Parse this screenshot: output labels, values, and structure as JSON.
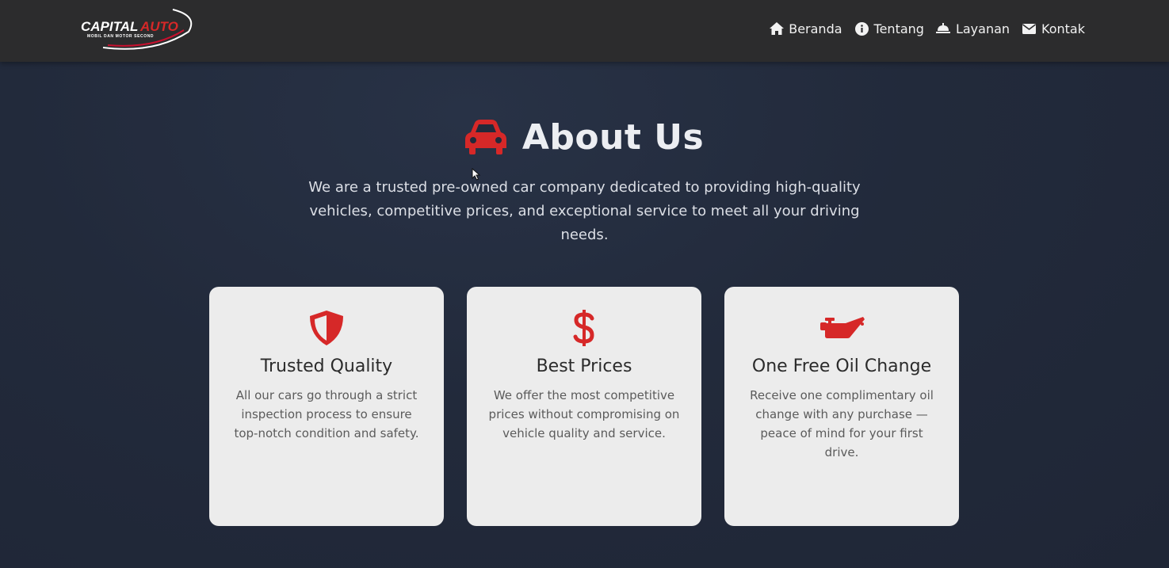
{
  "brand": {
    "name_part1": "CAPITAL",
    "name_part2": "AUTO",
    "tagline": "MOBIL DAN MOTOR SECOND"
  },
  "nav": {
    "items": [
      {
        "label": "Beranda",
        "icon": "home-icon"
      },
      {
        "label": "Tentang",
        "icon": "info-icon"
      },
      {
        "label": "Layanan",
        "icon": "service-bell-icon"
      },
      {
        "label": "Kontak",
        "icon": "envelope-icon"
      }
    ]
  },
  "hero": {
    "title": "About Us",
    "icon": "car-icon",
    "description": "We are a trusted pre-owned car company dedicated to providing high-quality vehicles, competitive prices, and exceptional service to meet all your driving needs."
  },
  "cards": [
    {
      "icon": "shield-icon",
      "title": "Trusted Quality",
      "text": "All our cars go through a strict inspection process to ensure top-notch condition and safety."
    },
    {
      "icon": "dollar-icon",
      "title": "Best Prices",
      "text": "We offer the most competitive prices without compromising on vehicle quality and service."
    },
    {
      "icon": "oil-can-icon",
      "title": "One Free Oil Change",
      "text": "Receive one complimentary oil change with any purchase — peace of mind for your first drive."
    }
  ],
  "colors": {
    "accent": "#d62828",
    "navbar": "#2c2c2d",
    "background": "#222a3b",
    "card": "#ececec"
  }
}
